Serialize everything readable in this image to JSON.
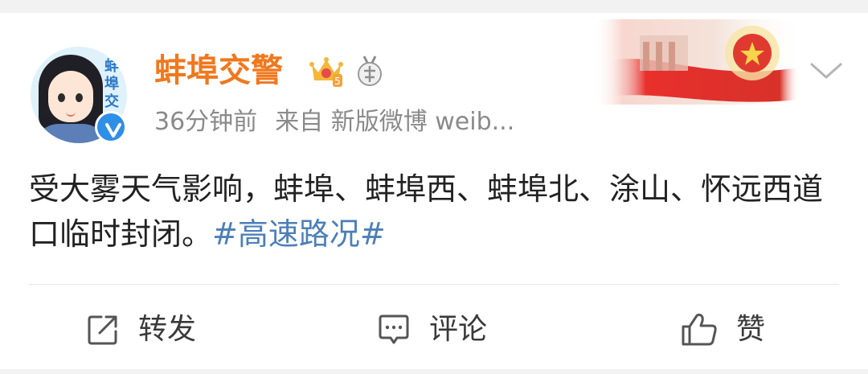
{
  "post": {
    "username": "蚌埠交警",
    "avatar_text": "蚌埠交",
    "meta": {
      "time": "36分钟前",
      "source": "来自 新版微博 weib..."
    },
    "content_text": "受大雾天气影响，蚌埠、蚌埠西、蚌埠北、涂山、怀远西道口临时封闭。",
    "hashtag": "#高速路况#",
    "actions": {
      "repost_label": "转发",
      "comment_label": "评论",
      "like_label": "赞"
    }
  },
  "icons": {
    "verified": "verified-icon",
    "crown": "crown-icon",
    "medal": "medal-icon",
    "chevron": "chevron-down-icon",
    "repost": "repost-icon",
    "comment": "comment-icon",
    "like": "like-icon"
  },
  "colors": {
    "username": "#f0781e",
    "hashtag": "#4d7fb8",
    "meta": "#8a8a8a",
    "verified": "#2f8ee6"
  }
}
